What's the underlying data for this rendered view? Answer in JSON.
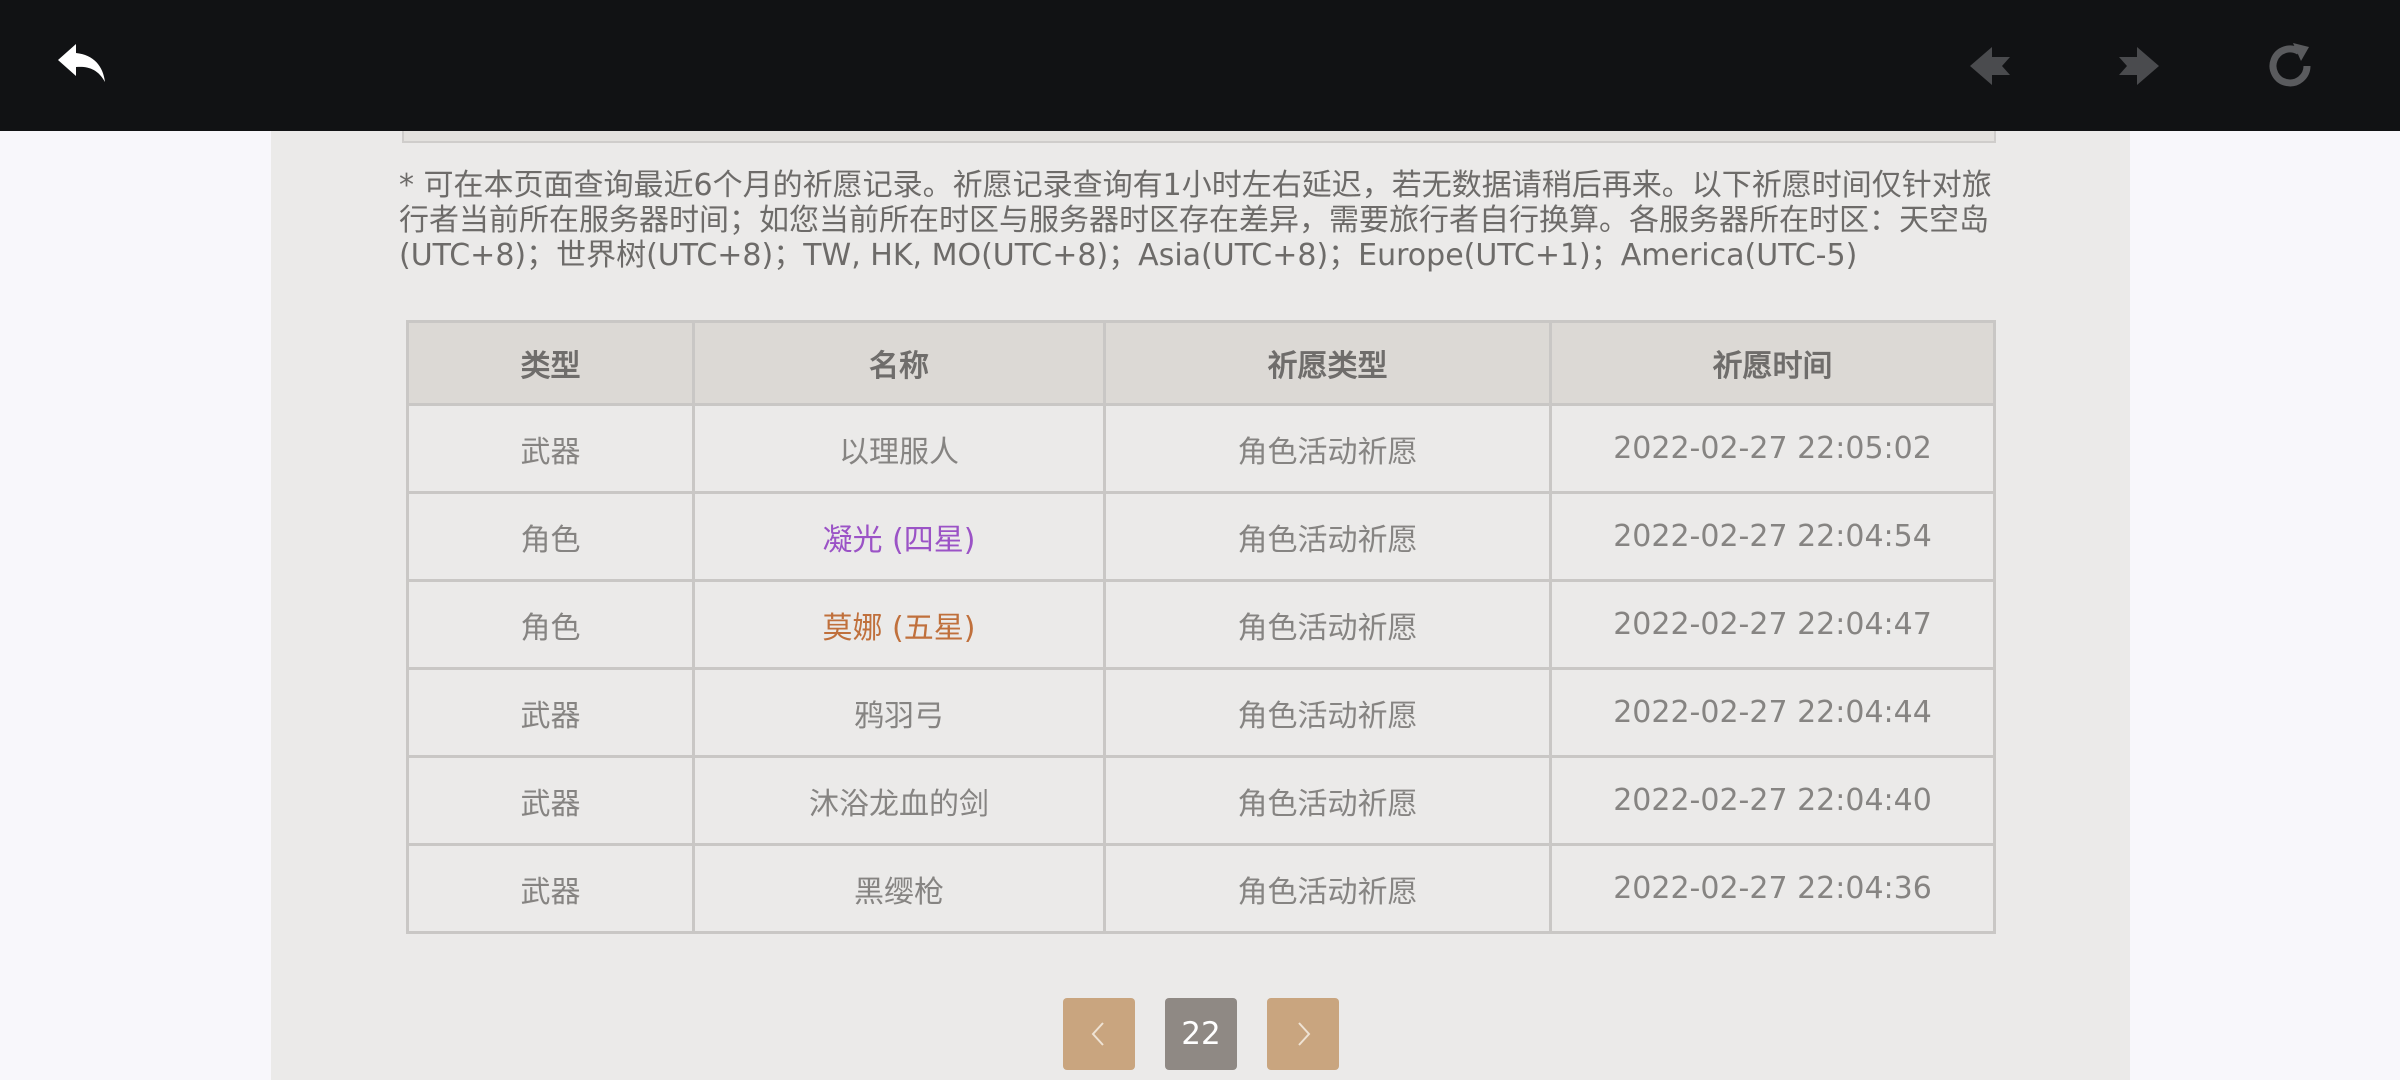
{
  "colors": {
    "topbar_bg": "#111214",
    "panel_bg": "#ebeae9",
    "header_bg": "#dcd9d5",
    "four_star": "#9b53c6",
    "five_star": "#c0703c",
    "pager_arrow": "#c9a57f",
    "pager_current": "#8f8984"
  },
  "toolbar": {
    "back_icon": "back-arrow-icon",
    "prev_icon": "nav-back-icon",
    "next_icon": "nav-forward-icon",
    "refresh_icon": "refresh-icon"
  },
  "notice": "* 可在本页面查询最近6个月的祈愿记录。祈愿记录查询有1小时左右延迟，若无数据请稍后再来。以下祈愿时间仅针对旅行者当前所在服务器时间；如您当前所在时区与服务器时区存在差异，需要旅行者自行换算。各服务器所在时区：天空岛(UTC+8)；世界树(UTC+8)；TW, HK, MO(UTC+8)；Asia(UTC+8)；Europe(UTC+1)；America(UTC-5)",
  "table": {
    "headers": [
      "类型",
      "名称",
      "祈愿类型",
      "祈愿时间"
    ],
    "rows": [
      {
        "type": "武器",
        "name": "以理服人",
        "wish": "角色活动祈愿",
        "time": "2022-02-27 22:05:02",
        "rarity": "normal"
      },
      {
        "type": "角色",
        "name": "凝光 (四星)",
        "wish": "角色活动祈愿",
        "time": "2022-02-27 22:04:54",
        "rarity": "four"
      },
      {
        "type": "角色",
        "name": "莫娜 (五星)",
        "wish": "角色活动祈愿",
        "time": "2022-02-27 22:04:47",
        "rarity": "five"
      },
      {
        "type": "武器",
        "name": "鸦羽弓",
        "wish": "角色活动祈愿",
        "time": "2022-02-27 22:04:44",
        "rarity": "normal"
      },
      {
        "type": "武器",
        "name": "沐浴龙血的剑",
        "wish": "角色活动祈愿",
        "time": "2022-02-27 22:04:40",
        "rarity": "normal"
      },
      {
        "type": "武器",
        "name": "黑缨枪",
        "wish": "角色活动祈愿",
        "time": "2022-02-27 22:04:36",
        "rarity": "normal"
      }
    ]
  },
  "pagination": {
    "prev_icon": "chevron-left-icon",
    "current_page": "22",
    "next_icon": "chevron-right-icon"
  }
}
